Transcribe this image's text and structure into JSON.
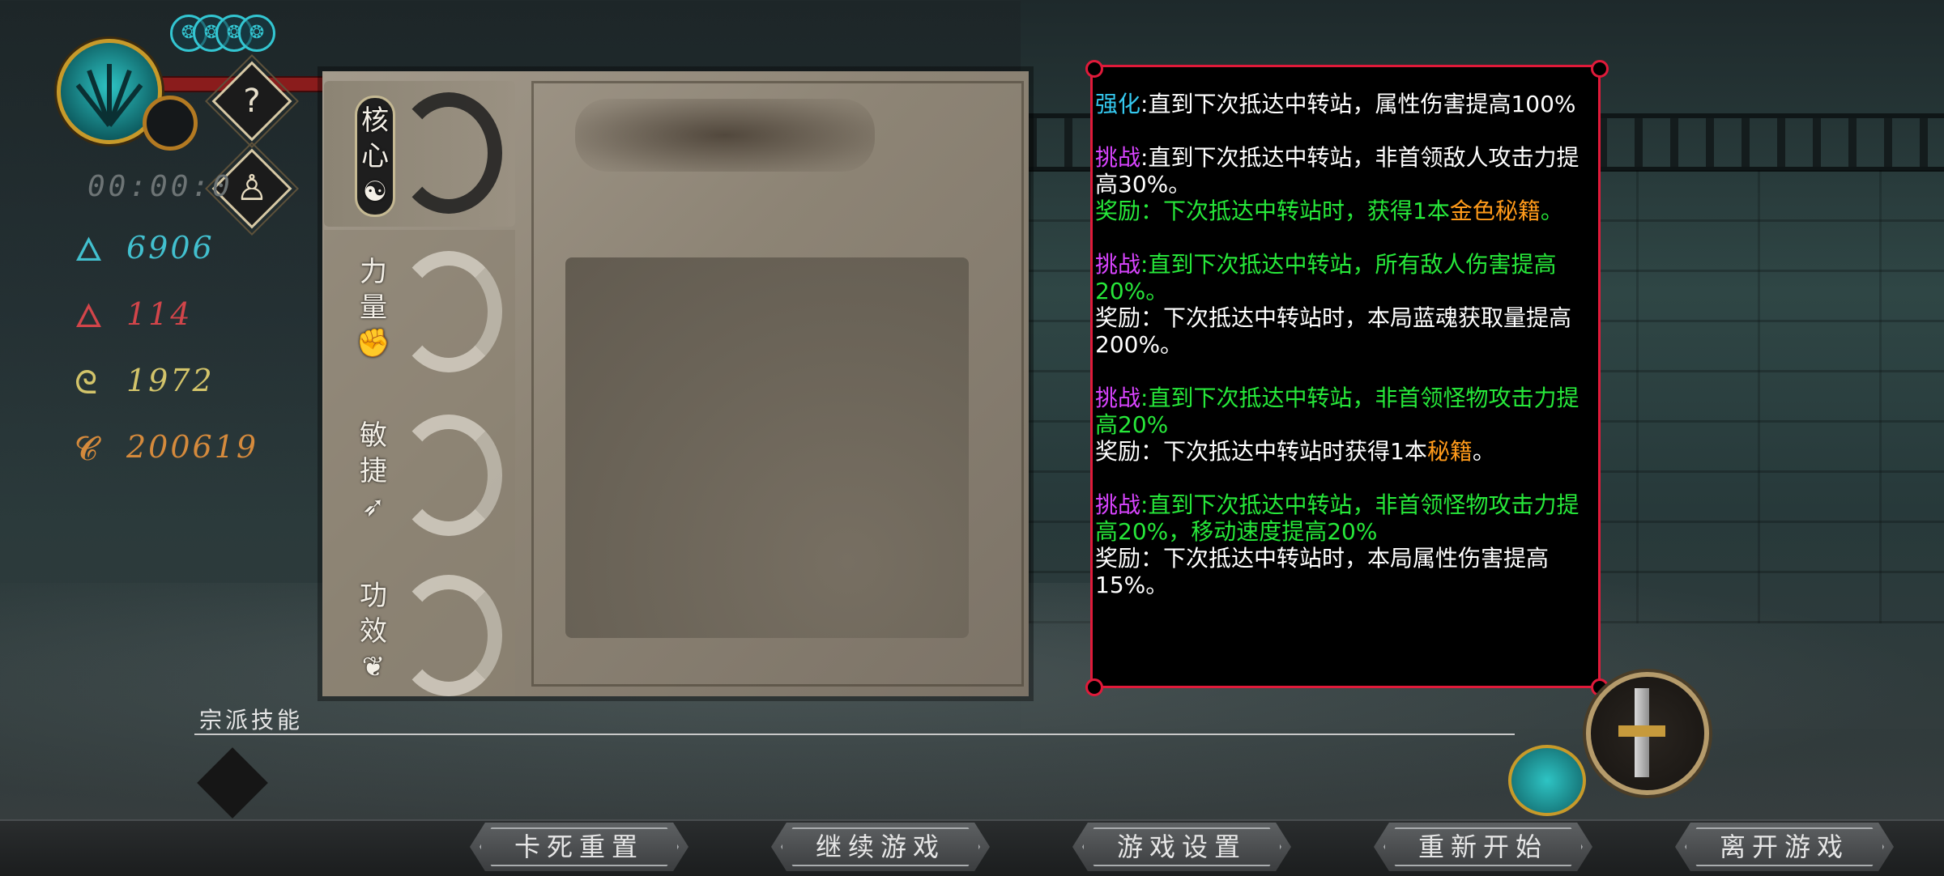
{
  "hud": {
    "timer": "00:00:0",
    "stats": [
      {
        "icon": "blue-soul-icon",
        "value": "6906",
        "color": "#42c0cf"
      },
      {
        "icon": "red-soul-icon",
        "value": "114",
        "color": "#d2454a"
      },
      {
        "icon": "gold-soul-icon",
        "value": "1972",
        "color": "#d3c46a"
      },
      {
        "icon": "coin-icon",
        "value": "200619",
        "color": "#d58a3c"
      }
    ],
    "help_symbol": "?"
  },
  "talent_tabs": [
    {
      "label": "核心",
      "symbol": "☯",
      "active": true
    },
    {
      "label": "力量",
      "symbol": "✊",
      "active": false
    },
    {
      "label": "敏捷",
      "symbol": "➶",
      "active": false
    },
    {
      "label": "功效",
      "symbol": "❦",
      "active": false
    }
  ],
  "info_box": {
    "enhance": {
      "tag": "强化",
      "text": ":直到下次抵达中转站，属性伤害提高100%"
    },
    "challenges": [
      {
        "tag": "挑战",
        "text": ":直到下次抵达中转站，非首领敌人攻击力提高30%。",
        "text_color": "#ffffff",
        "reward_prefix": "奖励：下次抵达中转站时，获得1本",
        "reward_highlight": "金色秘籍",
        "reward_suffix": "。",
        "reward_color": "#27e83a"
      },
      {
        "tag": "挑战",
        "text": ":直到下次抵达中转站，所有敌人伤害提高20%。",
        "text_color": "#27e83a",
        "reward_prefix": "奖励：下次抵达中转站时，本局蓝魂获取量提高 200%。",
        "reward_highlight": "",
        "reward_suffix": "",
        "reward_color": "#ffffff"
      },
      {
        "tag": "挑战",
        "text": ":直到下次抵达中转站，非首领怪物攻击力提高20%",
        "text_color": "#27e83a",
        "reward_prefix": "奖励：下次抵达中转站时获得1本",
        "reward_highlight": "秘籍",
        "reward_suffix": "。",
        "reward_color": "#ffffff"
      },
      {
        "tag": "挑战",
        "text": ":直到下次抵达中转站，非首领怪物攻击力提高20%，移动速度提高20%",
        "text_color": "#27e83a",
        "reward_prefix": "奖励：下次抵达中转站时，本局属性伤害提高15%。",
        "reward_highlight": "",
        "reward_suffix": "",
        "reward_color": "#ffffff"
      }
    ]
  },
  "sect_skills": {
    "label": "宗派技能"
  },
  "menu": {
    "buttons": [
      "卡死重置",
      "继续游戏",
      "游戏设置",
      "重新开始",
      "离开游戏"
    ]
  },
  "colors": {
    "frame_red": "#e01a3a",
    "tag_purple": "#d944ff",
    "tag_cyan": "#34c8ef",
    "highlight_orange": "#ff9a1a"
  }
}
